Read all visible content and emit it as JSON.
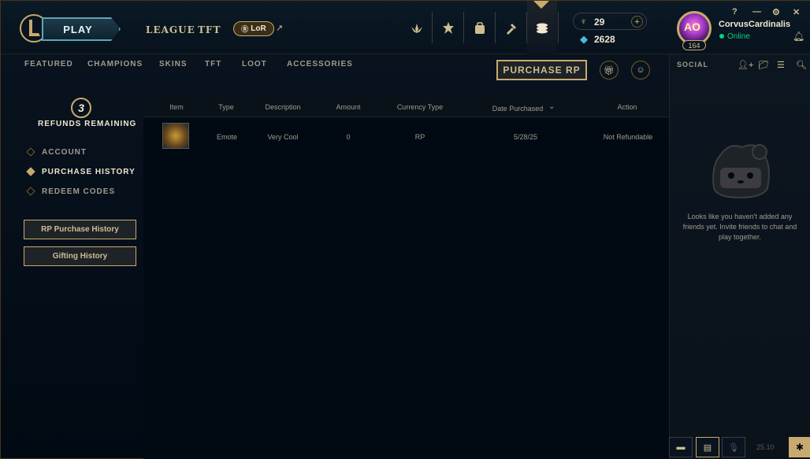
{
  "header": {
    "play_label": "PLAY",
    "nav": [
      "LEAGUE",
      "TFT"
    ],
    "lor_label": "LoR",
    "lor_ext_glyph": "↗",
    "currency": {
      "blue_essence": "29",
      "rp": "2628",
      "add_glyph": "+"
    },
    "profile": {
      "avatar_text": "AO",
      "level": "164",
      "username": "CorvusCardinalis",
      "status": "Online"
    },
    "window_controls": [
      "?",
      "—",
      "⚙",
      "✕"
    ]
  },
  "store_nav": {
    "tabs": [
      "FEATURED",
      "CHAMPIONS",
      "SKINS",
      "TFT",
      "LOOT",
      "ACCESSORIES"
    ],
    "purchase_rp_label": "PURCHASE RP"
  },
  "sidebar": {
    "refunds_count": "3",
    "refunds_label": "REFUNDS REMAINING",
    "items": [
      {
        "label": "ACCOUNT",
        "active": false
      },
      {
        "label": "PURCHASE HISTORY",
        "active": true
      },
      {
        "label": "REDEEM CODES",
        "active": false
      }
    ],
    "buttons": [
      "RP Purchase History",
      "Gifting History"
    ]
  },
  "table": {
    "headers": [
      "Item",
      "Type",
      "Description",
      "Amount",
      "Currency Type",
      "Date Purchased",
      "Action"
    ],
    "rows": [
      {
        "type": "Emote",
        "description": "Very Cool",
        "amount": "0",
        "currency": "RP",
        "date": "5/28/25",
        "action": "Not Refundable"
      }
    ]
  },
  "social": {
    "title": "SOCIAL",
    "empty_message": "Looks like you haven't added any friends yet. Invite friends to chat and play together."
  },
  "footer": {
    "version": "25.10"
  },
  "colors": {
    "gold": "#c8aa6e",
    "online": "#0acf83",
    "background": "#010a13"
  }
}
